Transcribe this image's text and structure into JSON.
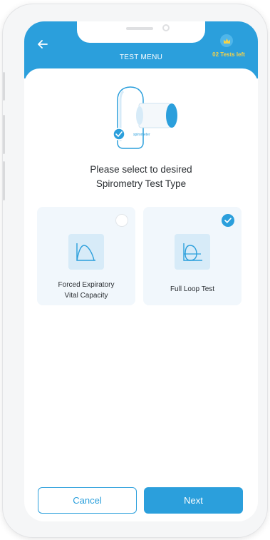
{
  "header": {
    "title": "TEST MENU",
    "tests_left": "02 Tests left",
    "back_icon": "arrow-left-icon",
    "crown_icon": "crown-icon"
  },
  "device_illustration": {
    "brand_text": "spirometer"
  },
  "prompt": {
    "line1": "Please select to desired",
    "line2": "Spirometry Test Type"
  },
  "options": [
    {
      "label_line1": "Forced Expiratory",
      "label_line2": "Vital Capacity",
      "selected": false,
      "icon": "fvc-curve-icon"
    },
    {
      "label_line1": "Full Loop Test",
      "label_line2": "",
      "selected": true,
      "icon": "flow-loop-icon"
    }
  ],
  "actions": {
    "cancel_label": "Cancel",
    "next_label": "Next"
  },
  "colors": {
    "primary": "#2b9fdc",
    "gold": "#f4d24a",
    "card_bg": "#f1f7fc",
    "icon_bg": "#d7ebf8",
    "text": "#2b2f33"
  }
}
